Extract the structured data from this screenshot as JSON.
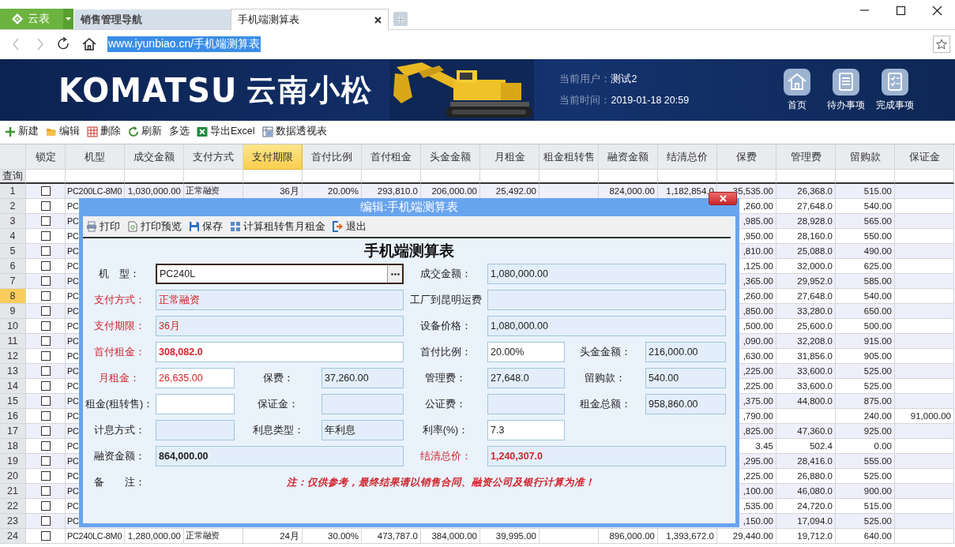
{
  "browser": {
    "app_label": "云表",
    "tabs": [
      {
        "label": "销售管理导航",
        "selected": false
      },
      {
        "label": "手机端测算表",
        "selected": true
      }
    ],
    "url": "www.iyunbiao.cn/手机端测算表",
    "url_selected": true
  },
  "banner": {
    "logo": "KOMATSU",
    "company": "云南小松",
    "user_label": "当前用户：",
    "user": "测试2",
    "time_label": "当前时间：",
    "time": "2019-01-18 20:59",
    "nav": [
      "首页",
      "待办事项",
      "完成事项"
    ]
  },
  "toolbar": [
    "新建",
    "编辑",
    "删除",
    "刷新",
    "多选",
    "导出Excel",
    "数据透视表"
  ],
  "table": {
    "lock_column": {
      "label": "锁定"
    },
    "columns": [
      {
        "label": "机型",
        "selected": false
      },
      {
        "label": "成交金额",
        "selected": false
      },
      {
        "label": "支付方式",
        "selected": false
      },
      {
        "label": "支付期限",
        "selected": true
      },
      {
        "label": "首付比例",
        "selected": false
      },
      {
        "label": "首付租金",
        "selected": false
      },
      {
        "label": "头金金额",
        "selected": false
      },
      {
        "label": "月租金",
        "selected": false
      },
      {
        "label": "租金租转售",
        "selected": false
      },
      {
        "label": "融资金额",
        "selected": false
      },
      {
        "label": "结清总价",
        "selected": false
      },
      {
        "label": "保费",
        "selected": false
      },
      {
        "label": "管理费",
        "selected": false
      },
      {
        "label": "留购款",
        "selected": false
      },
      {
        "label": "保证金",
        "selected": false
      }
    ],
    "query_label": "查询",
    "rows": [
      {
        "no": "1",
        "selected": false,
        "locked": false,
        "cells": [
          "PC200LC-8M0",
          "1,030,000.00",
          "正常融资",
          "36月",
          "20.00%",
          "293,810.0",
          "206,000.00",
          "25,492.00",
          null,
          "824,000.00",
          "1,182,854.0",
          "35,535.00",
          "26,368.0",
          "515.00",
          null
        ]
      },
      {
        "no": "2",
        "selected": false,
        "locked": false,
        "cells": [
          "PC",
          null,
          null,
          null,
          null,
          null,
          null,
          null,
          null,
          null,
          null,
          ",260.00",
          "27,648.0",
          "540.00",
          null
        ]
      },
      {
        "no": "3",
        "selected": false,
        "locked": false,
        "cells": [
          "PC",
          null,
          null,
          null,
          null,
          null,
          null,
          null,
          null,
          null,
          null,
          ",985.00",
          "28,928.0",
          "565.00",
          null
        ]
      },
      {
        "no": "4",
        "selected": false,
        "locked": false,
        "cells": [
          "PC",
          null,
          null,
          null,
          null,
          null,
          null,
          null,
          null,
          null,
          null,
          ",950.00",
          "28,160.0",
          "550.00",
          null
        ]
      },
      {
        "no": "5",
        "selected": false,
        "locked": false,
        "cells": [
          "PC",
          null,
          null,
          null,
          null,
          null,
          null,
          null,
          null,
          null,
          null,
          ",810.00",
          "25,088.0",
          "490.00",
          null
        ]
      },
      {
        "no": "6",
        "selected": false,
        "locked": false,
        "cells": [
          "PC",
          null,
          null,
          null,
          null,
          null,
          null,
          null,
          null,
          null,
          null,
          ",125.00",
          "32,000.0",
          "625.00",
          null
        ]
      },
      {
        "no": "7",
        "selected": false,
        "locked": false,
        "cells": [
          "PC",
          null,
          null,
          null,
          null,
          null,
          null,
          null,
          null,
          null,
          null,
          ",365.00",
          "29,952.0",
          "585.00",
          null
        ]
      },
      {
        "no": "8",
        "selected": true,
        "locked": false,
        "cells": [
          "PC",
          null,
          null,
          null,
          null,
          null,
          null,
          null,
          null,
          null,
          null,
          ",260.00",
          "27,648.0",
          "540.00",
          null
        ]
      },
      {
        "no": "9",
        "selected": false,
        "locked": false,
        "cells": [
          "PC",
          null,
          null,
          null,
          null,
          null,
          null,
          null,
          null,
          null,
          null,
          ",850.00",
          "33,280.0",
          "650.00",
          null
        ]
      },
      {
        "no": "10",
        "selected": false,
        "locked": false,
        "cells": [
          "PC",
          null,
          null,
          null,
          null,
          null,
          null,
          null,
          null,
          null,
          null,
          ",500.00",
          "25,600.0",
          "500.00",
          null
        ]
      },
      {
        "no": "11",
        "selected": false,
        "locked": false,
        "cells": [
          "PC",
          null,
          null,
          null,
          null,
          null,
          null,
          null,
          null,
          null,
          null,
          ",090.00",
          "32,208.0",
          "915.00",
          null
        ]
      },
      {
        "no": "12",
        "selected": false,
        "locked": false,
        "cells": [
          "PC",
          null,
          null,
          null,
          null,
          null,
          null,
          null,
          null,
          null,
          null,
          ",630.00",
          "31,856.0",
          "905.00",
          null
        ]
      },
      {
        "no": "13",
        "selected": false,
        "locked": false,
        "cells": [
          "PC",
          null,
          null,
          null,
          null,
          null,
          null,
          null,
          null,
          null,
          null,
          ",225.00",
          "33,600.0",
          "525.00",
          null
        ]
      },
      {
        "no": "14",
        "selected": false,
        "locked": false,
        "cells": [
          "PC",
          null,
          null,
          null,
          null,
          null,
          null,
          null,
          null,
          null,
          null,
          ",225.00",
          "33,600.0",
          "525.00",
          null
        ]
      },
      {
        "no": "15",
        "selected": false,
        "locked": false,
        "cells": [
          "PC",
          null,
          null,
          null,
          null,
          null,
          null,
          null,
          null,
          null,
          null,
          ",375.00",
          "44,800.0",
          "875.00",
          null
        ]
      },
      {
        "no": "16",
        "selected": false,
        "locked": false,
        "cells": [
          "PC",
          null,
          null,
          null,
          null,
          null,
          null,
          null,
          null,
          null,
          null,
          ",790.00",
          null,
          "240.00",
          "91,000.00"
        ]
      },
      {
        "no": "17",
        "selected": false,
        "locked": false,
        "cells": [
          "PC",
          null,
          null,
          null,
          null,
          null,
          null,
          null,
          null,
          null,
          null,
          ",825.00",
          "47,360.0",
          "925.00",
          null
        ]
      },
      {
        "no": "18",
        "selected": false,
        "locked": false,
        "cells": [
          "PC",
          null,
          null,
          null,
          null,
          null,
          null,
          null,
          null,
          null,
          null,
          "3.45",
          "502.4",
          "0.00",
          null
        ]
      },
      {
        "no": "19",
        "selected": false,
        "locked": false,
        "cells": [
          "PC",
          null,
          null,
          null,
          null,
          null,
          null,
          null,
          null,
          null,
          null,
          ",295.00",
          "28,416.0",
          "555.00",
          null
        ]
      },
      {
        "no": "20",
        "selected": false,
        "locked": false,
        "cells": [
          "PC",
          null,
          null,
          null,
          null,
          null,
          null,
          null,
          null,
          null,
          null,
          ",225.00",
          "26,880.0",
          "525.00",
          null
        ]
      },
      {
        "no": "21",
        "selected": false,
        "locked": false,
        "cells": [
          "PC",
          null,
          null,
          null,
          null,
          null,
          null,
          null,
          null,
          null,
          null,
          ",100.00",
          "46,080.0",
          "900.00",
          null
        ]
      },
      {
        "no": "22",
        "selected": false,
        "locked": false,
        "cells": [
          "PC",
          null,
          null,
          null,
          null,
          null,
          null,
          null,
          null,
          null,
          null,
          ",535.00",
          "24,720.0",
          "515.00",
          null
        ]
      },
      {
        "no": "23",
        "selected": false,
        "locked": false,
        "cells": [
          "PC",
          null,
          null,
          null,
          null,
          null,
          null,
          null,
          null,
          null,
          null,
          ",150.00",
          "17,094.0",
          "525.00",
          null
        ]
      },
      {
        "no": "24",
        "selected": false,
        "locked": false,
        "cells": [
          "PC240LC-8M0",
          "1,280,000.00",
          "正常融资",
          "24月",
          "30.00%",
          "473,787.0",
          "384,000.00",
          "39,995.00",
          null,
          "896,000.00",
          "1,393,672.0",
          "29,440.00",
          "19,712.0",
          "640.00",
          null
        ]
      }
    ]
  },
  "dialog": {
    "title": "编辑:手机端测算表",
    "toolbar": [
      "打印",
      "打印预览",
      "保存",
      "计算租转售月租金",
      "退出"
    ],
    "form": {
      "title": "手机端测算表",
      "rows": [
        [
          {
            "label": "机　型：",
            "value": "PC240L",
            "required": false,
            "editable": true,
            "bold": false,
            "wide": true,
            "focused": true,
            "picker": true
          },
          null,
          {
            "label": "成交金额：",
            "value": "1,080,000.00",
            "required": false,
            "editable": false,
            "bold": false,
            "wide": true,
            "focused": false,
            "picker": false
          }
        ],
        [
          {
            "label": "支付方式：",
            "value": "正常融资",
            "required": true,
            "editable": false,
            "bold": false,
            "wide": true,
            "focused": false,
            "picker": false
          },
          null,
          {
            "label": "工厂到昆明运费",
            "required": false,
            "editable": false,
            "wide": true,
            "focused": false,
            "picker": false
          }
        ],
        [
          {
            "label": "支付期限：",
            "value": "36月",
            "required": true,
            "editable": false,
            "bold": false,
            "wide": true,
            "focused": false,
            "picker": false
          },
          null,
          {
            "label": "设备价格：",
            "value": "1,080,000.00",
            "required": false,
            "editable": false,
            "bold": false,
            "wide": true,
            "focused": false,
            "picker": false
          }
        ],
        [
          {
            "label": "首付租金：",
            "value": "308,082.0",
            "required": true,
            "editable": true,
            "bold": true,
            "wide": true,
            "focused": false,
            "picker": false
          },
          null,
          {
            "label": "首付比例：",
            "value": "20.00%",
            "required": false,
            "editable": true,
            "bold": false,
            "wide": false,
            "focused": false,
            "picker": false
          },
          {
            "label": "头金金额：",
            "value": "216,000.00",
            "required": false,
            "editable": false,
            "bold": false,
            "wide": false,
            "focused": false,
            "picker": false
          }
        ],
        [
          {
            "label": "月租金：",
            "value": "26,635.00",
            "required": true,
            "editable": true,
            "bold": false,
            "wide": false,
            "focused": false,
            "picker": false
          },
          {
            "label": "保费：",
            "value": "37,260.00",
            "required": false,
            "editable": false,
            "bold": false,
            "wide": false,
            "focused": false,
            "picker": false
          },
          {
            "label": "管理费：",
            "value": "27,648.0",
            "required": false,
            "editable": false,
            "bold": false,
            "wide": false,
            "focused": false,
            "picker": false
          },
          {
            "label": "留购款：",
            "value": "540.00",
            "required": false,
            "editable": false,
            "bold": false,
            "wide": false,
            "focused": false,
            "picker": false
          }
        ],
        [
          {
            "label": "租金(租转售)：",
            "required": false,
            "editable": true,
            "wide": false,
            "focused": false,
            "picker": false
          },
          {
            "label": "保证金：",
            "required": false,
            "editable": false,
            "wide": false,
            "focused": false,
            "picker": false
          },
          {
            "label": "公证费：",
            "required": false,
            "editable": false,
            "wide": false,
            "focused": false,
            "picker": false
          },
          {
            "label": "租金总额：",
            "value": "958,860.00",
            "required": false,
            "editable": false,
            "bold": false,
            "wide": false,
            "focused": false,
            "picker": false
          }
        ],
        [
          {
            "label": "计息方式：",
            "required": false,
            "editable": false,
            "wide": false,
            "focused": false,
            "picker": false
          },
          {
            "label": "利息类型：",
            "value": "年利息",
            "required": false,
            "editable": false,
            "bold": false,
            "wide": false,
            "focused": false,
            "picker": false
          },
          {
            "label": "利率(%)：",
            "value": "7.3",
            "required": false,
            "editable": true,
            "bold": false,
            "wide": false,
            "focused": false,
            "picker": false
          }
        ],
        [
          {
            "label": "融资金额：",
            "value": "864,000.00",
            "required": false,
            "editable": false,
            "bold": true,
            "wide": true,
            "focused": false,
            "picker": false
          },
          null,
          {
            "label": "结清总价：",
            "value": "1,240,307.0",
            "required": true,
            "editable": false,
            "bold": true,
            "wide": true,
            "focused": false,
            "picker": false
          }
        ]
      ],
      "note": {
        "label": "备　　注：",
        "text": "注：仅供参考，最终结果请以销售合同、融资公司及银行计算为准！"
      }
    }
  }
}
